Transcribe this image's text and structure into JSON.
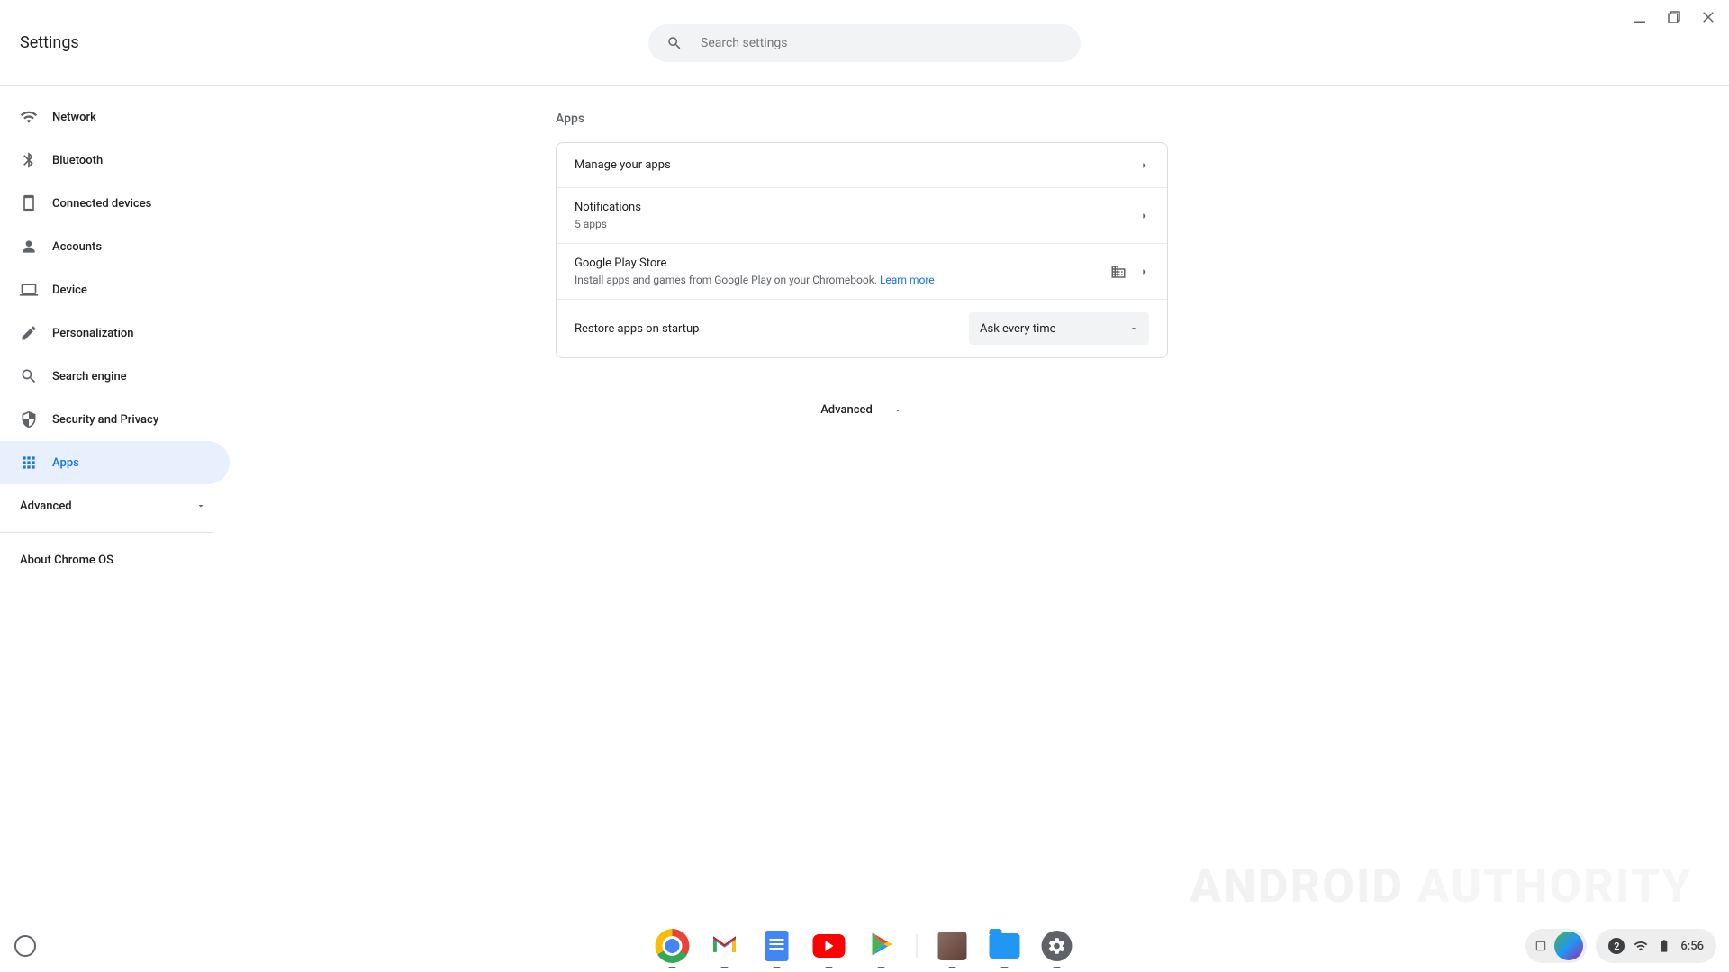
{
  "app_title": "Settings",
  "search": {
    "placeholder": "Search settings"
  },
  "sidebar": {
    "items": [
      {
        "label": "Network"
      },
      {
        "label": "Bluetooth"
      },
      {
        "label": "Connected devices"
      },
      {
        "label": "Accounts"
      },
      {
        "label": "Device"
      },
      {
        "label": "Personalization"
      },
      {
        "label": "Search engine"
      },
      {
        "label": "Security and Privacy"
      },
      {
        "label": "Apps"
      }
    ],
    "advanced": "Advanced",
    "about": "About Chrome OS"
  },
  "page": {
    "heading": "Apps",
    "rows": {
      "manage": {
        "title": "Manage your apps"
      },
      "notifications": {
        "title": "Notifications",
        "sub": "5 apps"
      },
      "play": {
        "title": "Google Play Store",
        "sub": "Install apps and games from Google Play on your Chromebook. ",
        "link": "Learn more"
      },
      "restore": {
        "title": "Restore apps on startup",
        "value": "Ask every time"
      }
    },
    "advanced_toggle": "Advanced"
  },
  "shelf": {
    "apps": [
      "Chrome",
      "Gmail",
      "Docs",
      "YouTube",
      "Play Store",
      "Package",
      "Files",
      "Settings"
    ]
  },
  "status": {
    "count": "2",
    "time": "6:56"
  },
  "watermark": {
    "l": "ANDROID",
    "r": "AUTHORITY"
  }
}
